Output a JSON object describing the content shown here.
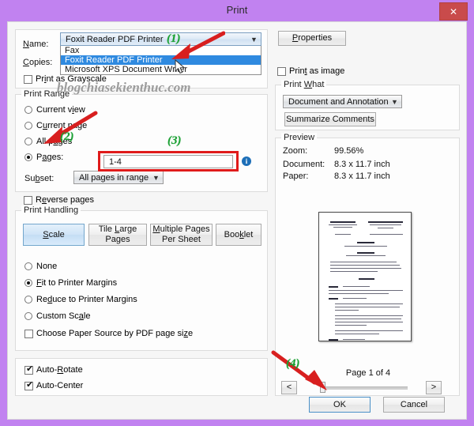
{
  "window": {
    "title": "Print",
    "close_label": "✕",
    "titlebar_color": "#c182f0",
    "close_color": "#c94b4b"
  },
  "watermark": "blogchiasekienthuc.com",
  "printer": {
    "name_label": "Name:",
    "copies_label": "Copies:",
    "selected": "Foxit Reader PDF Printer",
    "options": [
      "Fax",
      "Foxit Reader PDF Printer",
      "Microsoft XPS Document Writer"
    ],
    "selected_index": 1,
    "properties_button": "Properties",
    "print_as_grayscale": "Print as Grayscale",
    "print_as_grayscale_checked": false,
    "print_as_image": "Print as image",
    "print_as_image_checked": false
  },
  "print_range": {
    "legend": "Print Range",
    "options": [
      {
        "label": "Current view",
        "selected": false
      },
      {
        "label": "Current page",
        "selected": false
      },
      {
        "label": "All pages",
        "selected": false
      },
      {
        "label": "Pages:",
        "selected": true
      }
    ],
    "pages_value": "1-4",
    "subset_label": "Subset:",
    "subset_value": "All pages in range",
    "reverse_pages": "Reverse pages",
    "reverse_pages_checked": false,
    "info_icon": "i"
  },
  "print_handling": {
    "legend": "Print Handling",
    "mode_buttons": [
      {
        "label": "Scale",
        "selected": true
      },
      {
        "label": "Tile Large Pages",
        "selected": false
      },
      {
        "label": "Multiple Pages Per Sheet",
        "selected": false
      },
      {
        "label": "Booklet",
        "selected": false
      }
    ],
    "scale_options": [
      {
        "label": "None",
        "selected": false
      },
      {
        "label": "Fit to Printer Margins",
        "selected": true
      },
      {
        "label": "Reduce to Printer Margins",
        "selected": false
      },
      {
        "label": "Custom Scale",
        "selected": false
      }
    ],
    "paper_source": "Choose Paper Source by PDF page size",
    "paper_source_checked": false
  },
  "orientation": {
    "auto_rotate": "Auto-Rotate",
    "auto_rotate_checked": true,
    "auto_center": "Auto-Center",
    "auto_center_checked": true
  },
  "print_what": {
    "legend": "Print What",
    "value": "Document and Annotations",
    "summarize_button": "Summarize Comments"
  },
  "preview": {
    "legend": "Preview",
    "zoom_label": "Zoom:",
    "zoom_value": "99.56%",
    "document_label": "Document:",
    "document_value": "8.3 x 11.7 inch",
    "paper_label": "Paper:",
    "paper_value": "8.3 x 11.7 inch",
    "page_status": "Page 1 of 4",
    "prev_button": "<",
    "next_button": ">"
  },
  "footer": {
    "ok_button": "OK",
    "cancel_button": "Cancel"
  },
  "annotations": {
    "marker1": "(1)",
    "marker2": "(2)",
    "marker3": "(3)",
    "marker4": "(4)",
    "highlight_color": "#e01b1b",
    "marker_color": "#1aa033"
  }
}
